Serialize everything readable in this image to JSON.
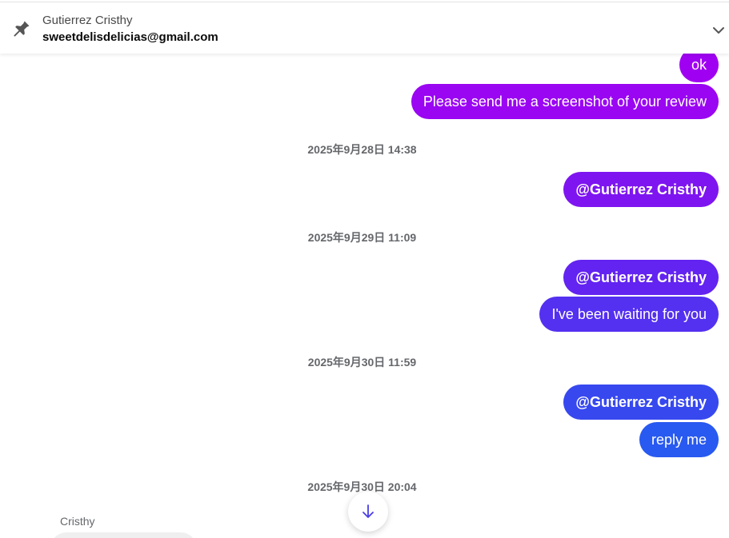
{
  "pinned": {
    "sender": "Gutierrez Cristhy",
    "text": "sweetdelisdelicias@gmail.com",
    "icon": "pin-icon",
    "expand_icon": "chevron-down-icon"
  },
  "messages": [
    {
      "text": "ok"
    },
    {
      "text": "Please send me a screenshot of your review"
    },
    {
      "timestamp": "2025年9月28日 14:38"
    },
    {
      "text": "@Gutierrez Cristhy"
    },
    {
      "timestamp": "2025年9月29日 11:09"
    },
    {
      "text": "@Gutierrez Cristhy"
    },
    {
      "text": "I've been waiting for you"
    },
    {
      "timestamp": "2025年9月30日 11:59"
    },
    {
      "text": "@Gutierrez Cristhy"
    },
    {
      "text": "reply me"
    },
    {
      "timestamp": "2025年9月30日 20:04"
    }
  ],
  "incoming": {
    "sender": "Cristhy"
  },
  "scroll_button": {
    "icon": "arrow-down-icon"
  },
  "colors": {
    "bubble_gradient_top": "#a100f2",
    "bubble_gradient_bottom": "#2563f0",
    "timestamp": "#65676b",
    "incoming_bubble": "#efefef"
  }
}
